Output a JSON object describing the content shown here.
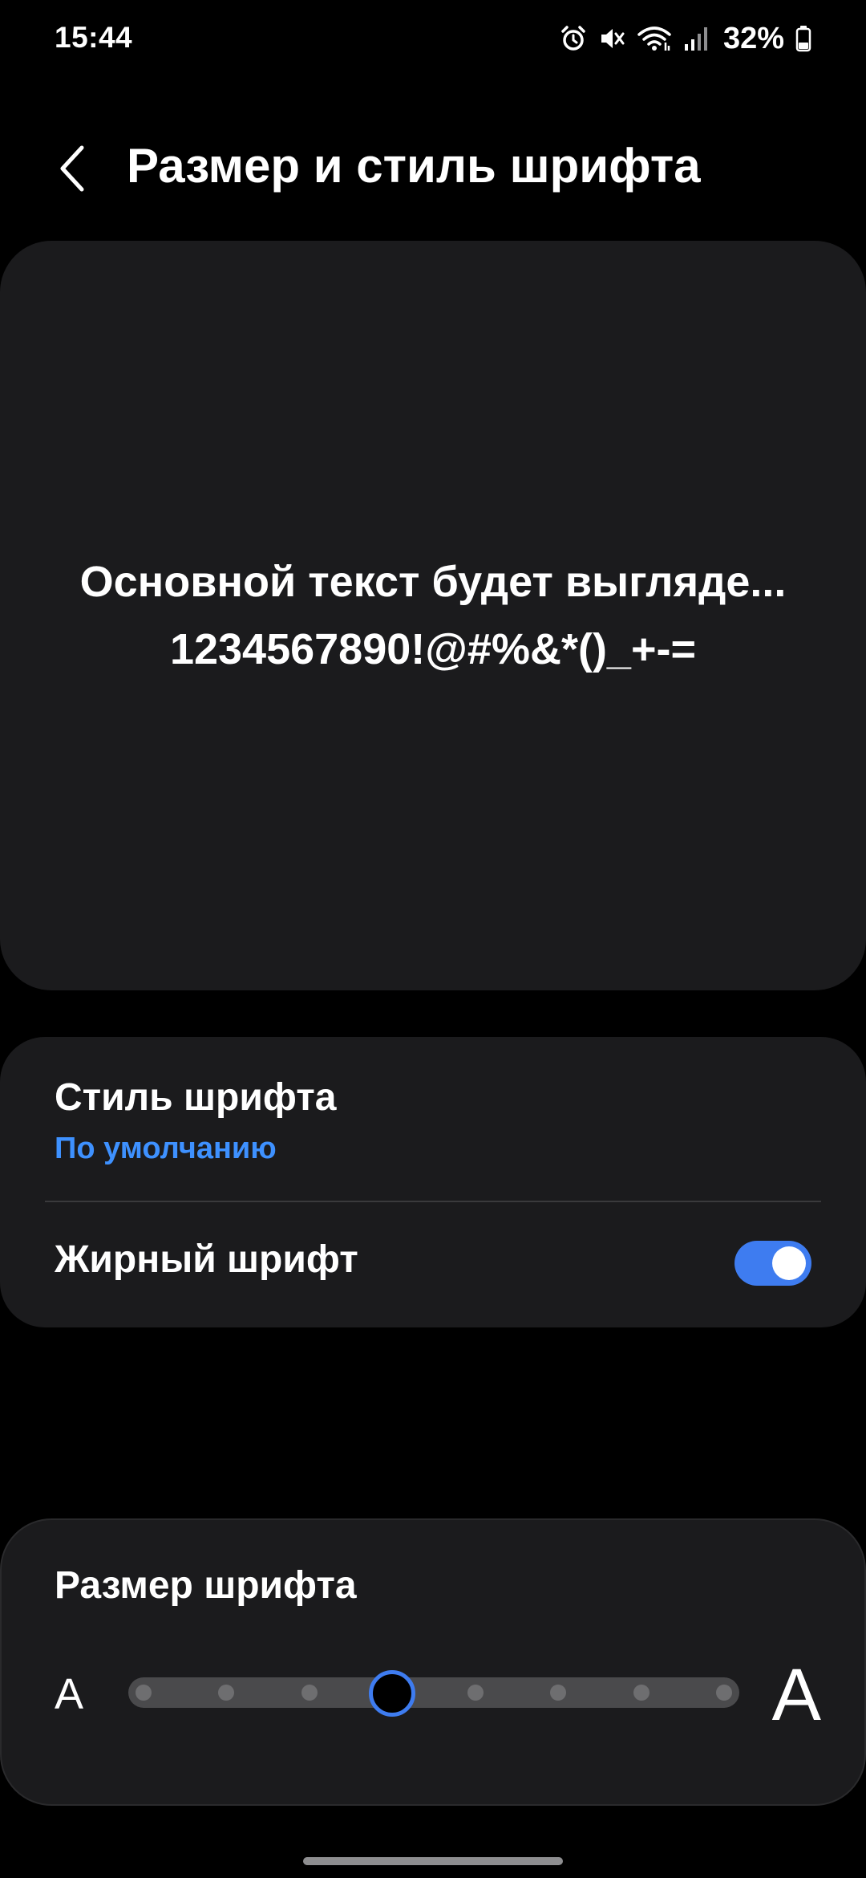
{
  "status_bar": {
    "time": "15:44",
    "battery_percent": "32%",
    "icons": [
      "alarm-icon",
      "mute-icon",
      "wifi-icon",
      "signal-icon",
      "battery-icon"
    ]
  },
  "header": {
    "back_icon": "chevron-left-icon",
    "title": "Размер и стиль шрифта"
  },
  "preview": {
    "line1": "Основной текст будет выгляде...",
    "line2": "1234567890!@#%&*()_+-="
  },
  "settings": {
    "font_style": {
      "title": "Стиль шрифта",
      "value": "По умолчанию"
    },
    "bold_font": {
      "title": "Жирный шрифт",
      "enabled": true
    }
  },
  "font_size": {
    "title": "Размер шрифта",
    "small_label": "A",
    "large_label": "A",
    "steps": 8,
    "selected_step": 4
  },
  "colors": {
    "accent": "#3e91ff",
    "toggle_on": "#3e7cf0",
    "card_bg": "#1b1b1d",
    "background": "#000000"
  }
}
